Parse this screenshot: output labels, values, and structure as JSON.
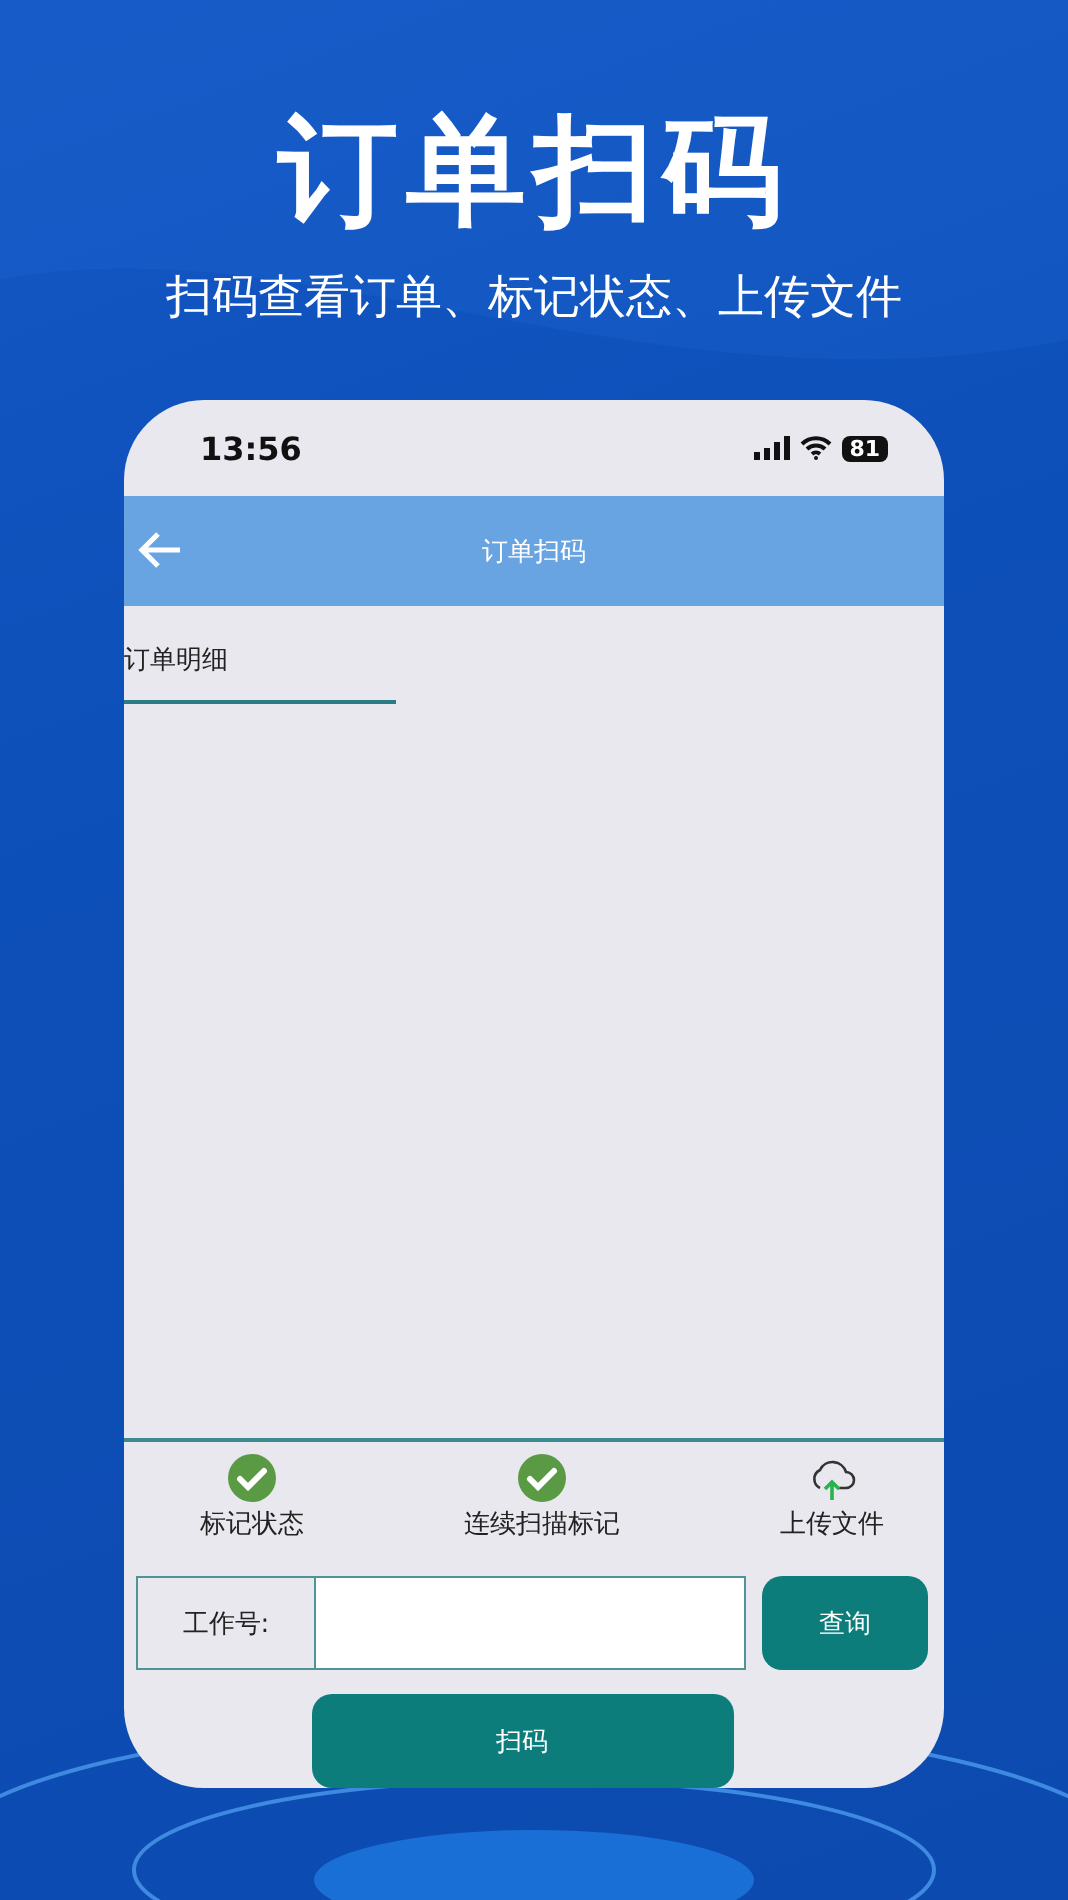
{
  "headline": "订单扫码",
  "subtitle": "扫码查看订单、标记状态、上传文件",
  "phone": {
    "status_bar": {
      "time": "13:56",
      "battery": "81"
    },
    "nav_bar": {
      "title": "订单扫码"
    },
    "tabs": [
      {
        "label": "订单明细",
        "selected": true
      }
    ],
    "actions": [
      {
        "kind": "check",
        "label": "标记状态"
      },
      {
        "kind": "check",
        "label": "连续扫描标记"
      },
      {
        "kind": "upload",
        "label": "上传文件"
      }
    ],
    "query_row": {
      "label": "工作号:",
      "button": "查询"
    },
    "scan_button": "扫码"
  }
}
